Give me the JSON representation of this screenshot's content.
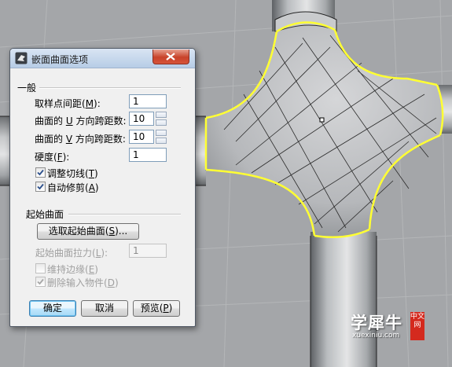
{
  "window": {
    "title": "嵌面曲面选项",
    "icon": "rhino-icon",
    "close_icon": "close-icon"
  },
  "general": {
    "header": "一般",
    "sample_spacing": {
      "label_pre": "取样点间距(",
      "key": "M",
      "label_post": "):",
      "value": "1"
    },
    "u_spans": {
      "label_pre": "曲面的 ",
      "key": "U",
      "label_post": " 方向跨距数:",
      "value": "10"
    },
    "v_spans": {
      "label_pre": "曲面的 ",
      "key": "V",
      "label_post": " 方向跨距数:",
      "value": "10"
    },
    "stiffness": {
      "label_pre": "硬度(",
      "key": "F",
      "label_post": "):",
      "value": "1"
    },
    "adjust_tangency": {
      "label_pre": "调整切线(",
      "key": "T",
      "label_post": ")",
      "checked": true
    },
    "auto_trim": {
      "label_pre": "自动修剪(",
      "key": "A",
      "label_post": ")",
      "checked": true
    }
  },
  "starting_surface": {
    "header": "起始曲面",
    "select_button": {
      "label_pre": "选取起始曲面(",
      "key": "S",
      "label_post": ")..."
    },
    "pull": {
      "label_pre": "起始曲面拉力(",
      "key": "L",
      "label_post": "):",
      "value": "1"
    },
    "preserve_edges": {
      "label_pre": "维持边缘(",
      "key": "E",
      "label_post": ")",
      "checked": false
    },
    "delete_input": {
      "label_pre": "删除输入物件(",
      "key": "D",
      "label_post": ")",
      "checked": true
    }
  },
  "buttons": {
    "ok": "确定",
    "cancel": "取消",
    "preview_pre": "预览(",
    "preview_key": "P",
    "preview_post": ")"
  },
  "watermark": {
    "main": "学犀牛",
    "sub": "xuexiniu.com",
    "badge": "中文网"
  },
  "colors": {
    "edge_highlight": "#ffff33",
    "viewport_bg": "#a4a6a9"
  }
}
